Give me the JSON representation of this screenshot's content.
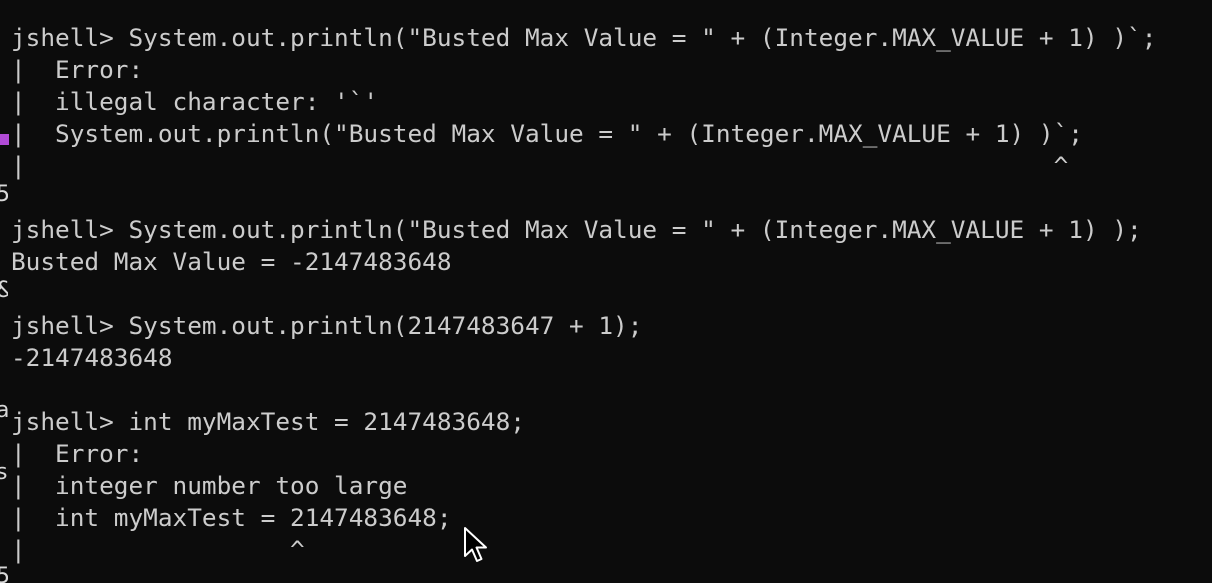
{
  "terminal": {
    "lines": [
      "jshell> System.out.println(\"Busted Max Value = \" + (Integer.MAX_VALUE + 1) )`;",
      "|  Error:",
      "|  illegal character: '`'",
      "|  System.out.println(\"Busted Max Value = \" + (Integer.MAX_VALUE + 1) )`;",
      "|                                                                      ^",
      "",
      "jshell> System.out.println(\"Busted Max Value = \" + (Integer.MAX_VALUE + 1) );",
      "Busted Max Value = -2147483648",
      "",
      "jshell> System.out.println(2147483647 + 1);",
      "-2147483648",
      "",
      "jshell> int myMaxTest = 2147483648;",
      "|  Error:",
      "|  integer number too large",
      "|  int myMaxTest = 2147483648;",
      "|                  ^"
    ]
  },
  "background_window": {
    "edge_glyphs": [
      "5",
      "&",
      "a",
      "s",
      "5"
    ]
  },
  "colors": {
    "background": "#0c0c0c",
    "foreground": "#cccccc",
    "accent": "#b14bd6"
  },
  "icons": {
    "pointer": "mouse-pointer-icon"
  }
}
